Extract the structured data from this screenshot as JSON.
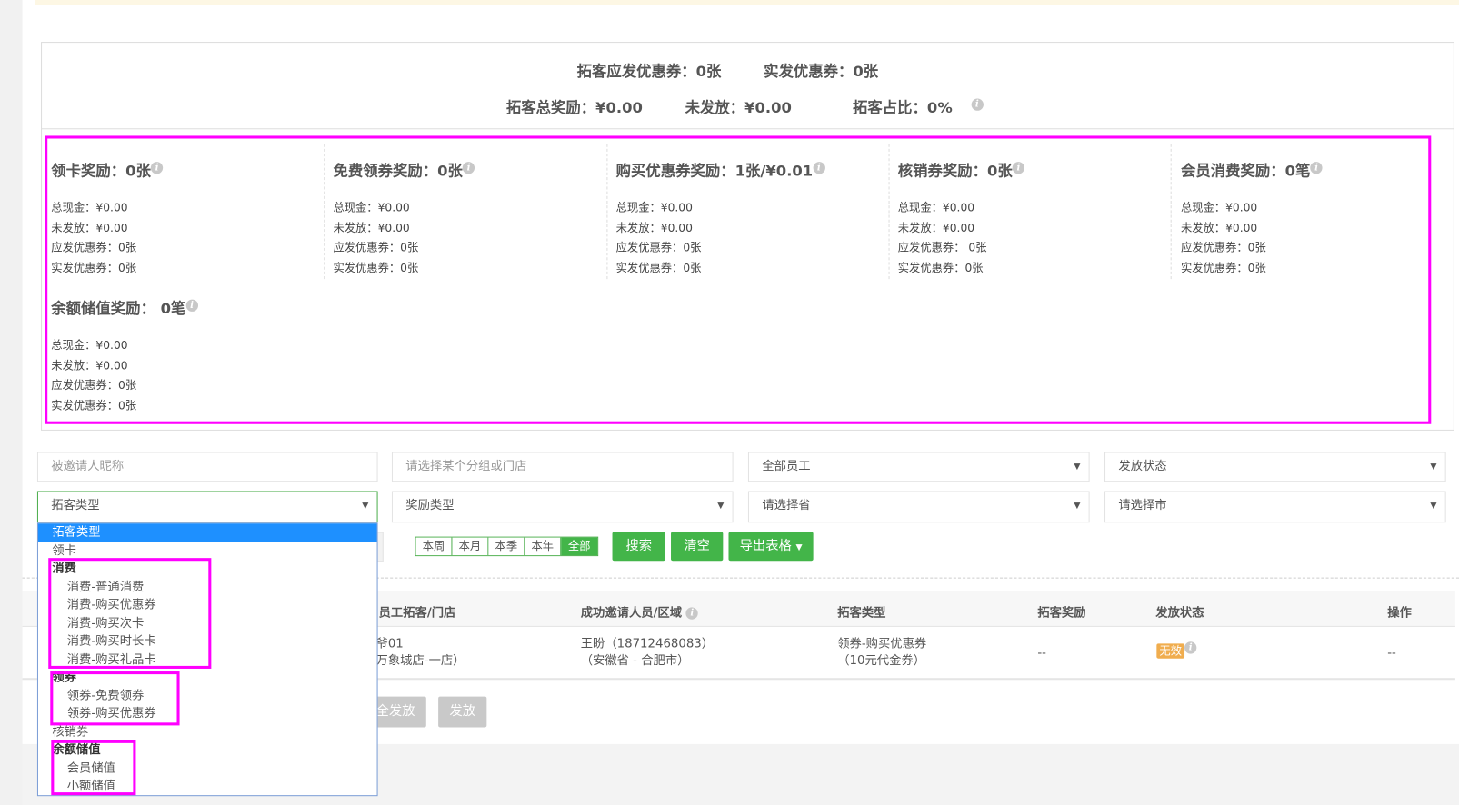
{
  "summary": {
    "should_issue": "拓客应发优惠券：0张",
    "actual_issue": "实发优惠券：0张",
    "total_reward": "拓客总奖励：¥0.00",
    "not_issued": "未发放：¥0.00",
    "ratio": "拓客占比：0%"
  },
  "reward_cards": [
    {
      "title": "领卡奖励：0张",
      "lines": [
        "总现金：¥0.00",
        "未发放：¥0.00",
        "应发优惠券：0张",
        "实发优惠券：0张"
      ]
    },
    {
      "title": "免费领券奖励：0张",
      "lines": [
        "总现金：¥0.00",
        "未发放：¥0.00",
        "应发优惠券：0张",
        "实发优惠券：0张"
      ]
    },
    {
      "title": "购买优惠券奖励：1张/¥0.01",
      "lines": [
        "总现金：¥0.00",
        "未发放：¥0.00",
        "应发优惠券：0张",
        "实发优惠券：0张"
      ]
    },
    {
      "title": "核销券奖励：0张",
      "lines": [
        "总现金：¥0.00",
        "未发放：¥0.00",
        "应发优惠券： 0张",
        "实发优惠券：0张"
      ]
    },
    {
      "title": "会员消费奖励：0笔",
      "lines": [
        "总现金：¥0.00",
        "未发放：¥0.00",
        "应发优惠券：0张",
        "实发优惠券：0张"
      ]
    },
    {
      "title": "余额储值奖励： 0笔",
      "lines": [
        "总现金：¥0.00",
        "未发放：¥0.00",
        "应发优惠券：0张",
        "实发优惠券：0张"
      ]
    }
  ],
  "filters": {
    "inviter_placeholder": "被邀请人昵称",
    "group_placeholder": "请选择某个分组或门店",
    "staff": "全部员工",
    "issue_status": "发放状态",
    "type": "拓客类型",
    "reward_type": "奖励类型",
    "province": "请选择省",
    "city": "请选择市"
  },
  "type_dropdown": {
    "selected": "拓客类型",
    "options": [
      {
        "label": "领卡"
      },
      {
        "label": "消费",
        "group": true
      },
      {
        "label": "消费-普通消费"
      },
      {
        "label": "消费-购买优惠券"
      },
      {
        "label": "消费-购买次卡"
      },
      {
        "label": "消费-购买时长卡"
      },
      {
        "label": "消费-购买礼品卡"
      },
      {
        "label": "领券",
        "group": true
      },
      {
        "label": "领券-免费领券"
      },
      {
        "label": "领券-购买优惠券"
      },
      {
        "label": "核销券"
      },
      {
        "label": "余额储值",
        "group": true
      },
      {
        "label": "会员储值"
      },
      {
        "label": "小额储值"
      }
    ]
  },
  "date_ranges": [
    "本周",
    "本月",
    "本季",
    "本年",
    "全部"
  ],
  "date_active": "全部",
  "actions": {
    "search": "搜索",
    "clear": "清空",
    "export": "导出表格"
  },
  "table": {
    "headers": [
      "员工拓客/门店",
      "成功邀请人员/区域",
      "拓客类型",
      "拓客奖励",
      "发放状态",
      "操作"
    ],
    "rows": [
      {
        "staff": "爷01",
        "store": "万象城店-一店）",
        "invitee": "王盼（18712468083）",
        "region": "（安徽省 - 合肥市）",
        "type": "领券-购买优惠券",
        "type_detail": "（10元代金券）",
        "reward": "--",
        "status": "无效",
        "action": "--"
      }
    ]
  },
  "bulk": {
    "all_issue": "全发放",
    "issue": "发放"
  },
  "colors": {
    "accent": "#43b549",
    "selected": "#1e90ff",
    "highlight": "#ff00ff",
    "badge": "#f0ad4e"
  }
}
